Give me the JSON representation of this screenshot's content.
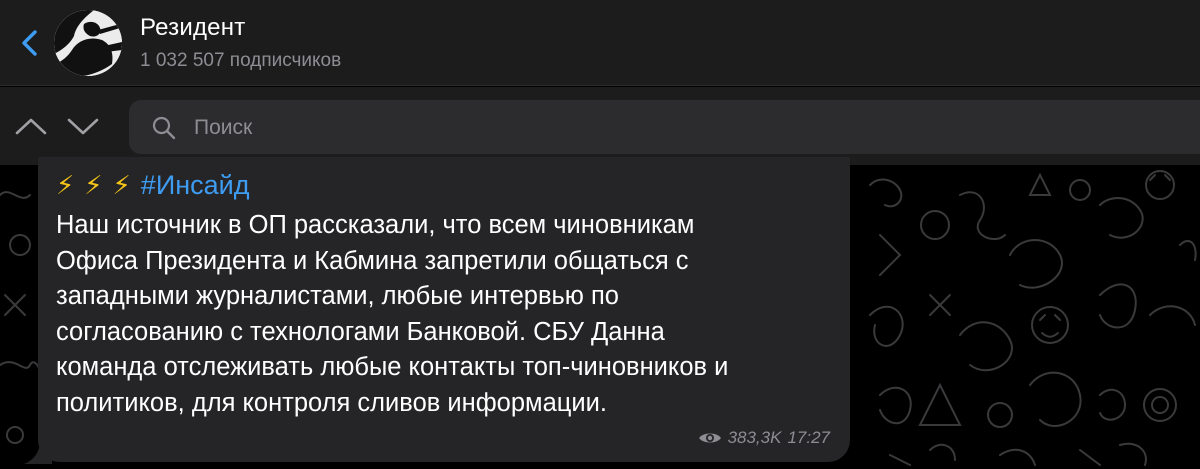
{
  "channel": {
    "name": "Резидент",
    "subscribers": "1 032 507 подписчиков"
  },
  "search": {
    "placeholder": "Поиск",
    "value": ""
  },
  "message": {
    "bolts": [
      "⚡",
      "⚡",
      "⚡"
    ],
    "hashtag": "#Инсайд",
    "text": "Наш источник в ОП рассказали, что всем чиновникам\nОфиса Президента и Кабмина запретили общаться с\nзападными журналистами, любые интервью по\nсогласованию с технологами Банковой. СБУ Данна\nкоманда отслеживать любые контакты топ-чиновников и\nполитиков, для контроля сливов информации.",
    "views": "383,3K",
    "time": "17:27"
  },
  "colors": {
    "header_bg": "#1c1c1d",
    "accent": "#3e9cf3",
    "bubble_bg": "#252527",
    "secondary_text": "#8d8d93",
    "bolt": "#f5c518"
  },
  "icons": {
    "back": "chevron-left-icon",
    "up": "chevron-up-icon",
    "down": "chevron-down-icon",
    "search": "search-icon",
    "views": "eye-icon"
  }
}
